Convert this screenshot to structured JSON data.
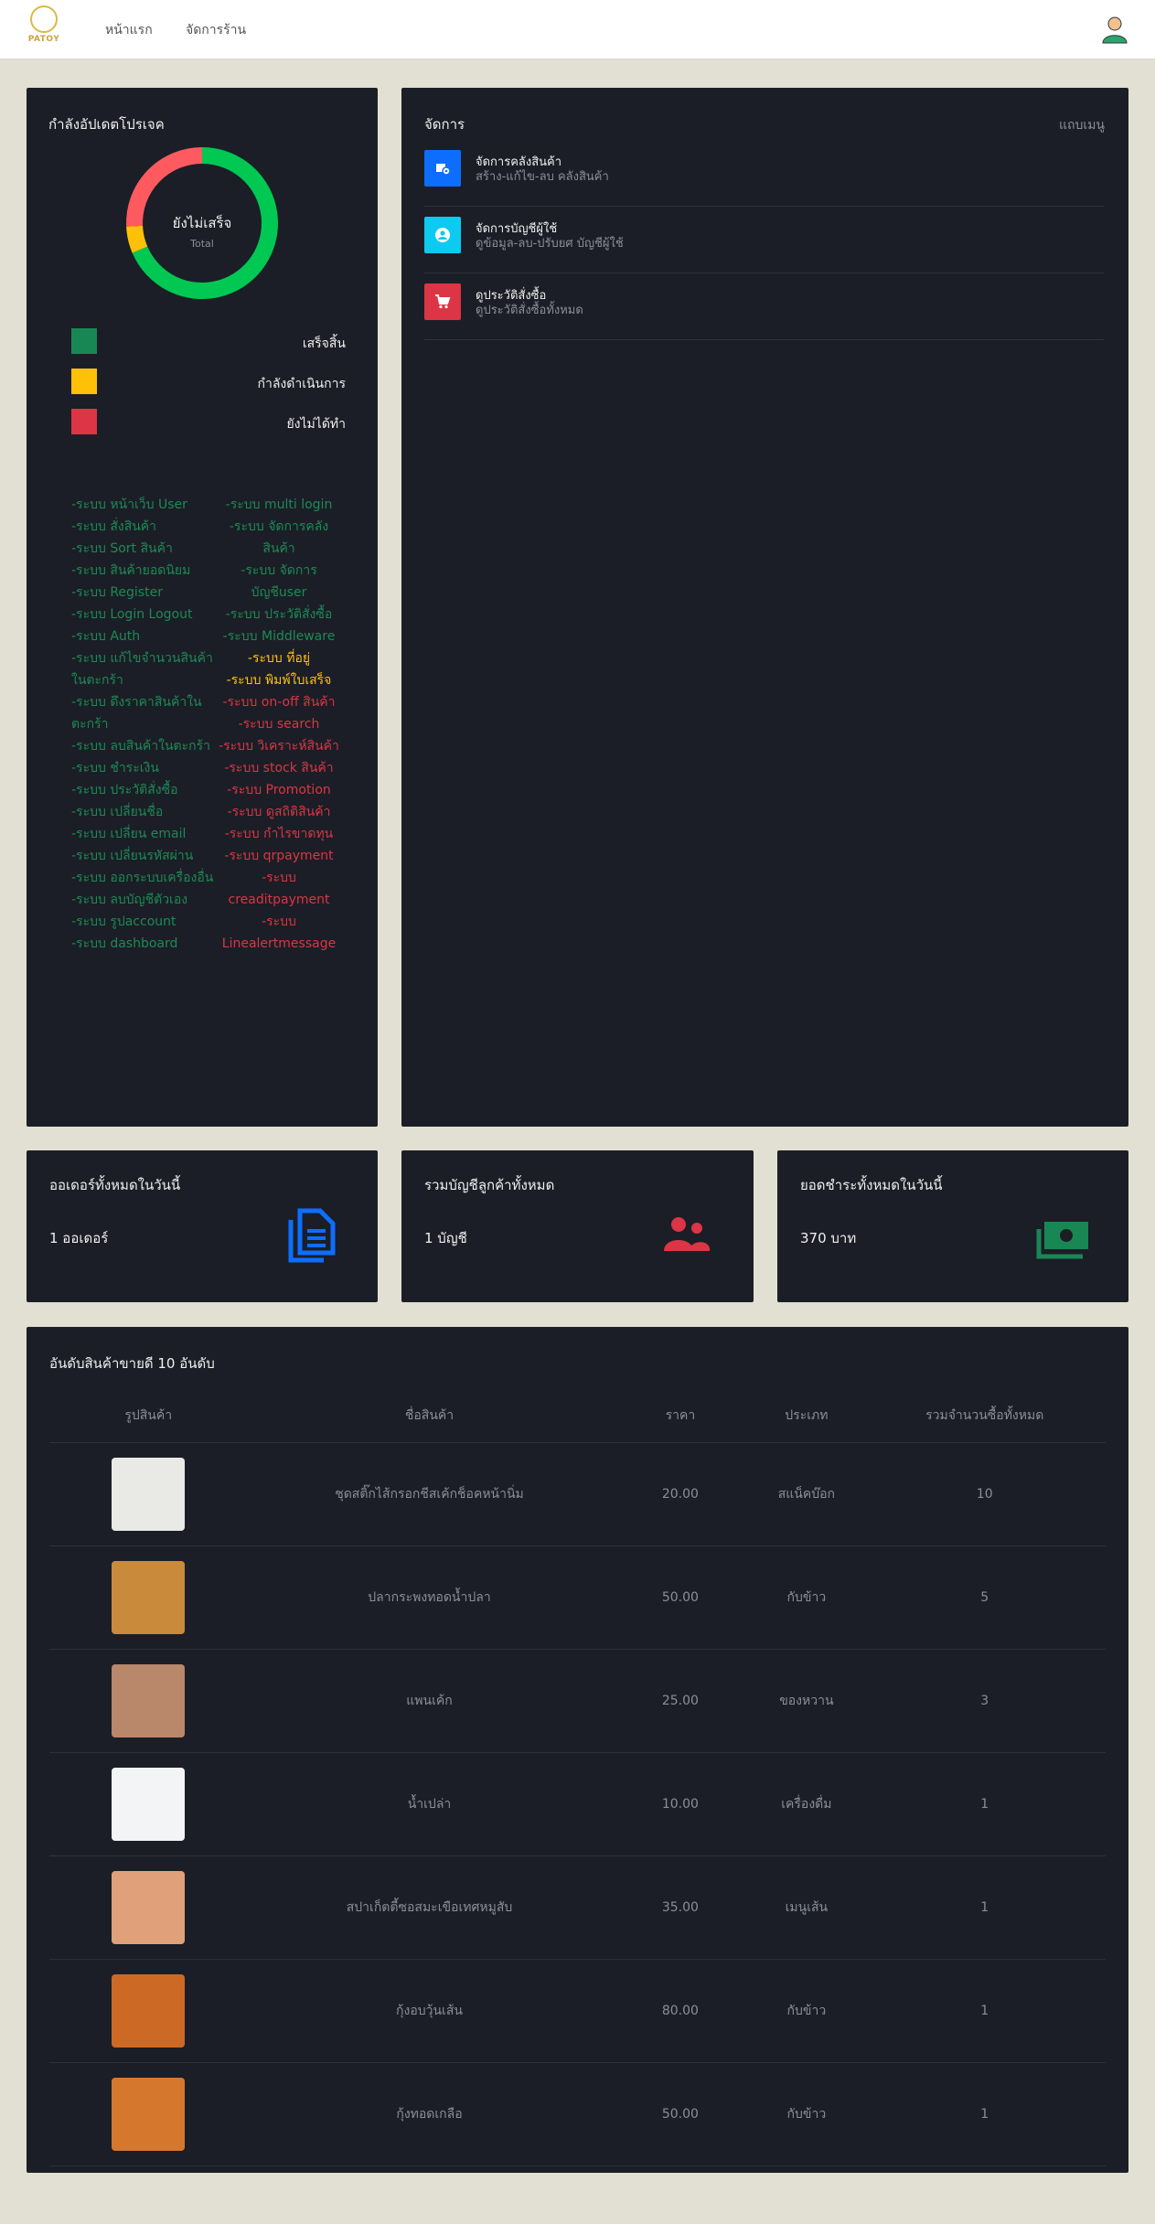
{
  "nav": {
    "brand": "PATOY",
    "links": [
      "หน้าแรก",
      "จัดการร้าน"
    ]
  },
  "progress": {
    "title": "กำลังอัปเดตโปรเจค",
    "donut_center": "ยังไม่เสร็จ",
    "donut_sub": "Total",
    "legend": [
      {
        "label": "เสร็จสิ้น",
        "color": "#198754"
      },
      {
        "label": "กำลังดำเนินการ",
        "color": "#ffc107"
      },
      {
        "label": "ยังไม่ได้ทำ",
        "color": "#dc3545"
      }
    ],
    "chart_data": {
      "type": "pie",
      "categories": [
        "เสร็จสิ้น",
        "กำลังดำเนินการ",
        "ยังไม่ได้ทำ"
      ],
      "values": [
        24,
        2,
        9
      ],
      "colors": [
        "#00c853",
        "#ffc107",
        "#ff5a5f"
      ]
    },
    "features_left": [
      {
        "text": "-ระบบ หน้าเว็บ User",
        "status": "g"
      },
      {
        "text": "-ระบบ สั่งสินค้า",
        "status": "g"
      },
      {
        "text": "-ระบบ Sort สินค้า",
        "status": "g"
      },
      {
        "text": "-ระบบ สินค้ายอดนิยม",
        "status": "g"
      },
      {
        "text": "-ระบบ Register",
        "status": "g"
      },
      {
        "text": "-ระบบ Login Logout",
        "status": "g"
      },
      {
        "text": "-ระบบ Auth",
        "status": "g"
      },
      {
        "text": "-ระบบ แก้ไขจำนวนสินค้าในตะกร้า",
        "status": "g"
      },
      {
        "text": "-ระบบ ดึงราคาสินค้าในตะกร้า",
        "status": "g"
      },
      {
        "text": "-ระบบ ลบสินค้าในตะกร้า",
        "status": "g"
      },
      {
        "text": "-ระบบ ชำระเงิน",
        "status": "g"
      },
      {
        "text": "-ระบบ ประวัติสั่งซื้อ",
        "status": "g"
      },
      {
        "text": "-ระบบ เปลี่ยนชื่อ",
        "status": "g"
      },
      {
        "text": "-ระบบ เปลี่ยน email",
        "status": "g"
      },
      {
        "text": "-ระบบ เปลี่ยนรหัสผ่าน",
        "status": "g"
      },
      {
        "text": "-ระบบ ออกระบบเครื่องอื่น",
        "status": "g"
      },
      {
        "text": "-ระบบ ลบบัญชีตัวเอง",
        "status": "g"
      },
      {
        "text": "-ระบบ รูปaccount",
        "status": "g"
      },
      {
        "text": "-ระบบ dashboard",
        "status": "g"
      }
    ],
    "features_right": [
      {
        "text": "-ระบบ multi login",
        "status": "g"
      },
      {
        "text": "-ระบบ จัดการคลังสินค้า",
        "status": "g"
      },
      {
        "text": "-ระบบ จัดการบัญชีuser",
        "status": "g"
      },
      {
        "text": "-ระบบ ประวัติสั่งซื้อ",
        "status": "g"
      },
      {
        "text": "-ระบบ Middleware",
        "status": "g"
      },
      {
        "text": "-ระบบ ที่อยู่",
        "status": "y"
      },
      {
        "text": "-ระบบ พิมพ์ใบเสร็จ",
        "status": "y"
      },
      {
        "text": "-ระบบ on-off สินค้า",
        "status": "r"
      },
      {
        "text": "-ระบบ search",
        "status": "r"
      },
      {
        "text": "-ระบบ วิเคราะห์สินค้า",
        "status": "r"
      },
      {
        "text": "-ระบบ stock สินค้า",
        "status": "r"
      },
      {
        "text": "-ระบบ Promotion",
        "status": "r"
      },
      {
        "text": "-ระบบ ดูสถิติสินค้า",
        "status": "r"
      },
      {
        "text": "-ระบบ กำไรขาดทุน",
        "status": "r"
      },
      {
        "text": "-ระบบ qrpayment",
        "status": "r"
      },
      {
        "text": "-ระบบ creaditpayment",
        "status": "r"
      },
      {
        "text": "-ระบบ Linealertmessage",
        "status": "r"
      }
    ]
  },
  "manage": {
    "title": "จัดการ",
    "menu_toggle": "แถบเมนู",
    "items": [
      {
        "title": "จัดการคลังสินค้า",
        "subtitle": "สร้าง-แก้ไข-ลบ คลังสินค้า",
        "color": "#0d6efd",
        "icon": "box-gear-icon"
      },
      {
        "title": "จัดการบัญชีผู้ใช้",
        "subtitle": "ดูข้อมูล-ลบ-ปรับยศ บัญชีผู้ใช้",
        "color": "#0dcaf0",
        "icon": "user-circle-icon"
      },
      {
        "title": "ดูประวัติสั่งซื้อ",
        "subtitle": "ดูประวัติสั่งซื้อทั้งหมด",
        "color": "#dc3545",
        "icon": "cart-icon"
      }
    ]
  },
  "stats": [
    {
      "title": "ออเดอร์ทั้งหมดในวันนี้",
      "value": "1 ออเดอร์",
      "icon": "document-icon",
      "color": "#0d6efd"
    },
    {
      "title": "รวมบัญชีลูกค้าทั้งหมด",
      "value": "1 บัญชี",
      "icon": "users-icon",
      "color": "#dc3545"
    },
    {
      "title": "ยอดชำระทั้งหมดในวันนี้",
      "value": "370 บาท",
      "icon": "money-icon",
      "color": "#198754"
    }
  ],
  "top_products": {
    "title": "อันดับสินค้าขายดี 10 อันดับ",
    "columns": [
      "รูปสินค้า",
      "ชื่อสินค้า",
      "ราคา",
      "ประเภท",
      "รวมจำนวนซื้อทั้งหมด"
    ],
    "rows": [
      {
        "name": "ชุดสติ๊กไส้กรอกชีสเค้กช็อคหน้านิ่ม",
        "price": "20.00",
        "type": "สแน็คบ๊อก",
        "qty": "10",
        "thumb": "#e9e9e6"
      },
      {
        "name": "ปลากระพงทอดน้ำปลา",
        "price": "50.00",
        "type": "กับข้าว",
        "qty": "5",
        "thumb": "#c98a3c"
      },
      {
        "name": "แพนเค้ก",
        "price": "25.00",
        "type": "ของหวาน",
        "qty": "3",
        "thumb": "#b9876a"
      },
      {
        "name": "น้ำเปล่า",
        "price": "10.00",
        "type": "เครื่องดื่ม",
        "qty": "1",
        "thumb": "#f3f4f6"
      },
      {
        "name": "สปาเก็ตตี้ซอสมะเขือเทศหมูสับ",
        "price": "35.00",
        "type": "เมนูเส้น",
        "qty": "1",
        "thumb": "#e0a07a"
      },
      {
        "name": "กุ้งอบวุ้นเส้น",
        "price": "80.00",
        "type": "กับข้าว",
        "qty": "1",
        "thumb": "#cc6a25"
      },
      {
        "name": "กุ้งทอดเกลือ",
        "price": "50.00",
        "type": "กับข้าว",
        "qty": "1",
        "thumb": "#d6772e"
      }
    ]
  }
}
